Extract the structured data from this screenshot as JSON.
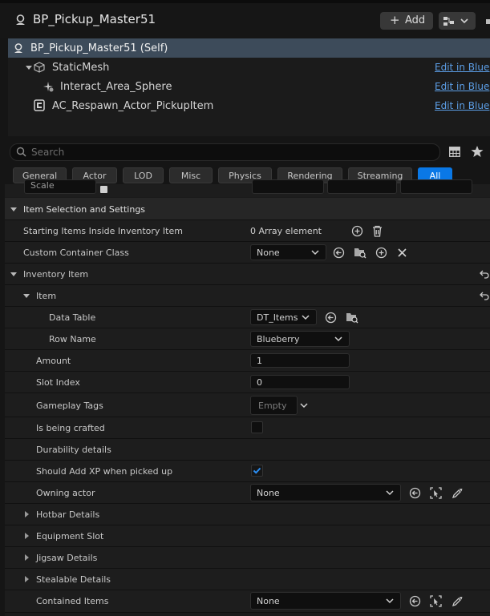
{
  "header": {
    "title": "BP_Pickup_Master51",
    "add_label": "Add"
  },
  "tree": {
    "self_label": "BP_Pickup_Master51 (Self)",
    "items": [
      {
        "label": "StaticMesh",
        "edit": "Edit in Blueprint"
      },
      {
        "label": "Interact_Area_Sphere",
        "edit": "Edit in Blueprint"
      },
      {
        "label": "AC_Respawn_Actor_PickupItem",
        "edit": "Edit in Blueprint"
      }
    ]
  },
  "search": {
    "placeholder": "Search"
  },
  "tabs": [
    "General",
    "Actor",
    "LOD",
    "Misc",
    "Physics",
    "Rendering",
    "Streaming",
    "All"
  ],
  "active_tab": "All",
  "top_cut": {
    "scale_label": "Scale"
  },
  "section": {
    "title": "Item Selection and Settings",
    "starting_items": {
      "label": "Starting Items Inside Inventory Item",
      "value": "0 Array element"
    },
    "custom_container": {
      "label": "Custom Container Class",
      "value": "None"
    },
    "inventory_item": {
      "label": "Inventory Item"
    },
    "item": {
      "label": "Item"
    },
    "data_table": {
      "label": "Data Table",
      "value": "DT_Items"
    },
    "row_name": {
      "label": "Row Name",
      "value": "Blueberry"
    },
    "amount": {
      "label": "Amount",
      "value": "1"
    },
    "slot_index": {
      "label": "Slot Index",
      "value": "0"
    },
    "gameplay_tags": {
      "label": "Gameplay Tags",
      "value": "Empty"
    },
    "is_being_crafted": {
      "label": "Is being crafted",
      "checked": false
    },
    "durability": {
      "label": "Durability details"
    },
    "should_add_xp": {
      "label": "Should Add XP when picked up",
      "checked": true
    },
    "owning_actor": {
      "label": "Owning actor",
      "value": "None"
    },
    "hotbar": {
      "label": "Hotbar Details"
    },
    "equipment": {
      "label": "Equipment Slot"
    },
    "jigsaw": {
      "label": "Jigsaw Details"
    },
    "stealable": {
      "label": "Stealable Details"
    },
    "contained": {
      "label": "Contained Items",
      "value": "None"
    }
  },
  "colors": {
    "accent": "#0a78e6",
    "selection": "#3d4b5a",
    "link": "#5c9ee6"
  }
}
